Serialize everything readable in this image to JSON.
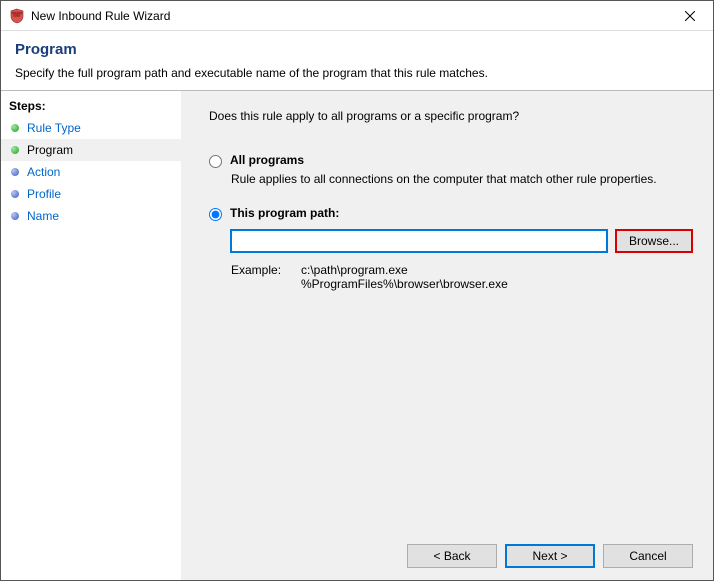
{
  "window": {
    "title": "New Inbound Rule Wizard"
  },
  "header": {
    "title": "Program",
    "subtitle": "Specify the full program path and executable name of the program that this rule matches."
  },
  "sidebar": {
    "label": "Steps:",
    "items": [
      {
        "label": "Rule Type",
        "state": "completed"
      },
      {
        "label": "Program",
        "state": "current"
      },
      {
        "label": "Action",
        "state": "pending"
      },
      {
        "label": "Profile",
        "state": "pending"
      },
      {
        "label": "Name",
        "state": "pending"
      }
    ]
  },
  "content": {
    "question": "Does this rule apply to all programs or a specific program?",
    "option_all": {
      "label": "All programs",
      "desc": "Rule applies to all connections on the computer that match other rule properties."
    },
    "option_path": {
      "label": "This program path:",
      "value": "",
      "browse": "Browse...",
      "example_label": "Example:",
      "example_text": "c:\\path\\program.exe\n%ProgramFiles%\\browser\\browser.exe"
    }
  },
  "buttons": {
    "back": "< Back",
    "next": "Next >",
    "cancel": "Cancel"
  }
}
